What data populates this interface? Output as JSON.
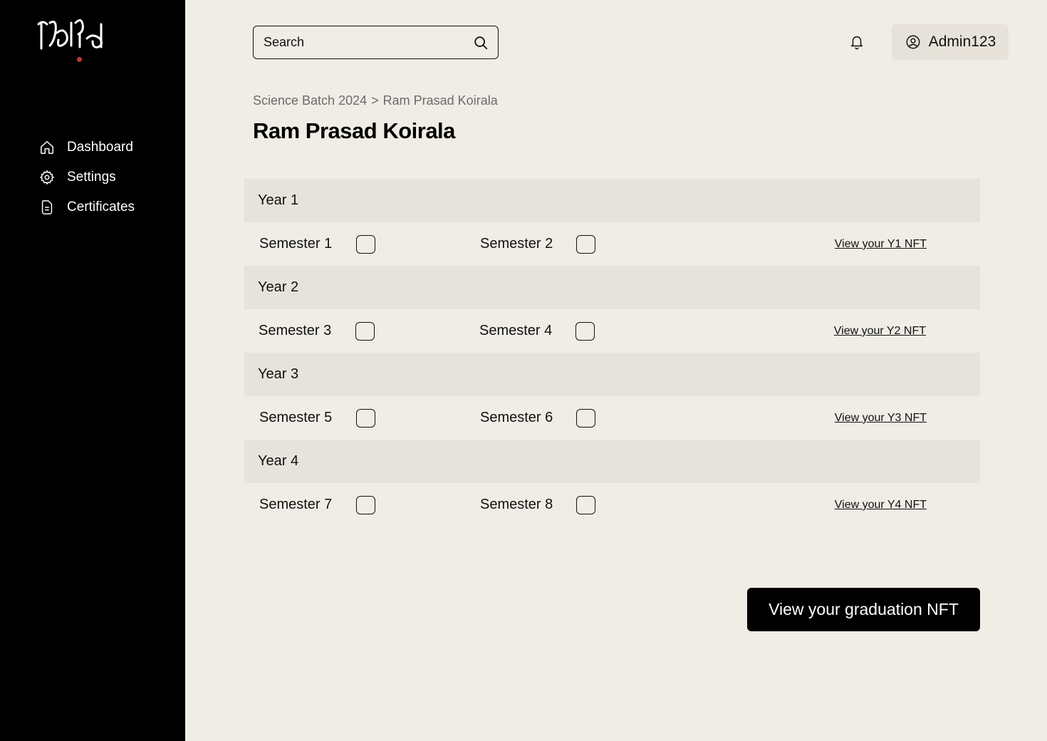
{
  "brand": {
    "logo_text": "ftd",
    "accent": "#c0392b"
  },
  "sidebar": {
    "items": [
      {
        "label": "Dashboard",
        "icon": "home-icon"
      },
      {
        "label": "Settings",
        "icon": "gear-icon"
      },
      {
        "label": "Certificates",
        "icon": "certificate-icon"
      }
    ]
  },
  "header": {
    "search_placeholder": "Search",
    "account_label": "Admin123"
  },
  "breadcrumb": {
    "parent": "Science Batch 2024",
    "separator": ">",
    "current": "Ram Prasad Koirala"
  },
  "page_title": "Ram Prasad Koirala",
  "years": [
    {
      "label": "Year 1",
      "sem_a": "Semester 1",
      "sem_b": "Semester 2",
      "nft_link": "View your Y1 NFT",
      "sem_a_checked": false,
      "sem_b_checked": false
    },
    {
      "label": "Year 2",
      "sem_a": "Semester 3",
      "sem_b": "Semester 4",
      "nft_link": "View your Y2 NFT",
      "sem_a_checked": false,
      "sem_b_checked": false
    },
    {
      "label": "Year 3",
      "sem_a": "Semester 5",
      "sem_b": "Semester 6",
      "nft_link": "View your Y3 NFT",
      "sem_a_checked": false,
      "sem_b_checked": false
    },
    {
      "label": "Year 4",
      "sem_a": "Semester 7",
      "sem_b": "Semester 8",
      "nft_link": "View your Y4 NFT",
      "sem_a_checked": false,
      "sem_b_checked": false
    }
  ],
  "graduation_button": "View your graduation NFT",
  "colors": {
    "sidebar_bg": "#000000",
    "page_bg": "#f0ede6",
    "year_header_bg": "#e6e3dc",
    "account_bg": "#e6e2da"
  }
}
